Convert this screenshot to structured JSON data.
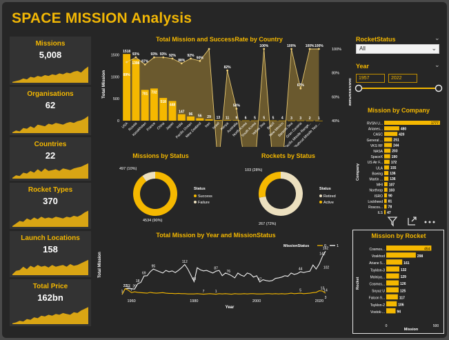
{
  "title": "SPACE MISSION Analysis",
  "kpis": [
    {
      "label": "Missions",
      "value": "5,008"
    },
    {
      "label": "Organisations",
      "value": "62"
    },
    {
      "label": "Countries",
      "value": "22"
    },
    {
      "label": "Rocket Types",
      "value": "370"
    },
    {
      "label": "Launch Locations",
      "value": "158"
    },
    {
      "label": "Total Price",
      "value": "162bn"
    }
  ],
  "slicers": {
    "rocket_status_label": "RocketStatus",
    "rocket_status_value": "All",
    "year_label": "Year",
    "year_from": "1957",
    "year_to": "2022"
  },
  "colors": {
    "accent": "#f5b800",
    "dark_fill": "#6e5c2e",
    "panel": "#333333",
    "background": "#262626"
  },
  "chart_data": [
    {
      "type": "bar",
      "title": "Total Mission and SuccessRate by Country",
      "xlabel": "",
      "ylabel": "Total Mission",
      "y2label": "SuccessRate",
      "categories": [
        "USA",
        "Russia",
        "Kazakhstan",
        "France",
        "China",
        "Japan",
        "India",
        "Pacific Ocean",
        "New Zealand",
        "Iran",
        "Israel",
        "Kenya",
        "Australia",
        "North Korea",
        "South Korea",
        "Yellow Sea",
        "Brazil",
        "New Mexico",
        "Barents Sea",
        "Gran Canaria",
        "Pacific Missile Range...",
        "Shahrud Missile Test ..."
      ],
      "series": [
        {
          "values": [
            1518,
            1398,
            701,
            732,
            518,
            448,
            147,
            96,
            56,
            29,
            13,
            11,
            9,
            6,
            5,
            5,
            5,
            4,
            3,
            3,
            2,
            1
          ]
        },
        {
          "values": [
            89,
            93,
            87,
            93,
            93,
            92,
            88,
            92,
            90,
            100,
            0,
            82,
            50,
            0,
            0,
            100,
            0,
            0,
            100,
            67,
            100,
            100
          ]
        }
      ],
      "bar_labels": [
        "1518",
        "1398",
        "701",
        "732",
        "518",
        "448",
        "147",
        "96",
        "56",
        "29",
        "13",
        "11",
        "9",
        "6",
        "5",
        "5",
        "5",
        "4",
        "3",
        "3",
        "2",
        "1"
      ],
      "rate_labels": [
        "89%",
        "93%",
        "87%",
        "93%",
        "93%",
        "92%",
        "88%",
        "92%",
        "90%",
        "",
        "",
        "82%",
        "50%",
        "",
        "",
        "100%",
        "",
        "",
        "100%",
        "67%",
        "100%",
        "100%"
      ],
      "y2_ticks": [
        "100%",
        "80%",
        "60%",
        "40%"
      ]
    },
    {
      "type": "pie",
      "title": "Missions by Status",
      "legend_title": "Status",
      "categories": [
        "Success",
        "Failure"
      ],
      "values": [
        4534,
        497
      ],
      "labels": [
        "4534 (90%)",
        "497 (10%)"
      ],
      "colors": [
        "#f5b800",
        "#ece0bf"
      ]
    },
    {
      "type": "pie",
      "title": "Rockets by Status",
      "legend_title": "Status",
      "categories": [
        "Retired",
        "Active"
      ],
      "values": [
        267,
        103
      ],
      "labels": [
        "267 (72%)",
        "103 (28%)"
      ],
      "colors": [
        "#ece0bf",
        "#f5b800"
      ]
    },
    {
      "type": "line",
      "title": "Total Mission by Year and MissionStatus",
      "legend_title": "MissionStatus",
      "xlabel": "Year",
      "ylabel": "Total Mission",
      "x_ticks": [
        "1960",
        "1980",
        "2000",
        "2020"
      ],
      "xlim": [
        1957,
        2022
      ],
      "series": [
        {
          "name": "1",
          "points": [
            [
              1957,
              0
            ],
            [
              1958,
              22
            ],
            [
              1959,
              22
            ],
            [
              1960,
              21
            ],
            [
              1961,
              20
            ],
            [
              1962,
              40
            ],
            [
              1963,
              45
            ],
            [
              1964,
              69
            ],
            [
              1965,
              70
            ],
            [
              1966,
              85
            ],
            [
              1967,
              95
            ],
            [
              1968,
              90
            ],
            [
              1969,
              85
            ],
            [
              1970,
              80
            ],
            [
              1971,
              90
            ],
            [
              1972,
              85
            ],
            [
              1973,
              88
            ],
            [
              1974,
              82
            ],
            [
              1975,
              90
            ],
            [
              1976,
              100
            ],
            [
              1977,
              112
            ],
            [
              1978,
              95
            ],
            [
              1979,
              72
            ],
            [
              1980,
              48
            ],
            [
              1981,
              100
            ],
            [
              1982,
              92
            ],
            [
              1983,
              88
            ],
            [
              1984,
              90
            ],
            [
              1985,
              85
            ],
            [
              1986,
              80
            ],
            [
              1987,
              87
            ],
            [
              1988,
              90
            ],
            [
              1989,
              70
            ],
            [
              1990,
              80
            ],
            [
              1991,
              76
            ],
            [
              1992,
              70
            ],
            [
              1993,
              62
            ],
            [
              1994,
              80
            ],
            [
              1995,
              72
            ],
            [
              1996,
              68
            ],
            [
              1997,
              80
            ],
            [
              1998,
              76
            ],
            [
              1999,
              65
            ],
            [
              2000,
              70
            ],
            [
              2001,
              47
            ],
            [
              2002,
              55
            ],
            [
              2003,
              52
            ],
            [
              2004,
              50
            ],
            [
              2005,
              52
            ],
            [
              2006,
              60
            ],
            [
              2007,
              62
            ],
            [
              2008,
              65
            ],
            [
              2009,
              70
            ],
            [
              2010,
              68
            ],
            [
              2011,
              80
            ],
            [
              2012,
              75
            ],
            [
              2013,
              78
            ],
            [
              2014,
              85
            ],
            [
              2015,
              82
            ],
            [
              2016,
              85
            ],
            [
              2017,
              87
            ],
            [
              2018,
              110
            ],
            [
              2019,
              95
            ],
            [
              2020,
              114
            ],
            [
              2021,
              142
            ],
            [
              2022,
              162
            ]
          ],
          "point_labels": {
            "1958": "22",
            "1959": "22",
            "1961": "20",
            "1962": "18",
            "1964": "69",
            "1967": "95",
            "1977": "112",
            "1980": "48",
            "1987": "87",
            "1991": "76",
            "2001": "47",
            "2014": "44",
            "2021": "142",
            "2022": "162"
          }
        },
        {
          "name": "0",
          "points": [
            [
              1957,
              1
            ],
            [
              1958,
              22
            ],
            [
              1959,
              16
            ],
            [
              1960,
              7
            ],
            [
              1961,
              10
            ],
            [
              1962,
              8
            ],
            [
              1963,
              7
            ],
            [
              1964,
              6
            ],
            [
              1965,
              5
            ],
            [
              1966,
              8
            ],
            [
              1967,
              6
            ],
            [
              1968,
              5
            ],
            [
              1969,
              6
            ],
            [
              1970,
              7
            ],
            [
              1971,
              5
            ],
            [
              1972,
              4
            ],
            [
              1973,
              4
            ],
            [
              1974,
              3
            ],
            [
              1975,
              4
            ],
            [
              1976,
              3
            ],
            [
              1977,
              3
            ],
            [
              1978,
              2
            ],
            [
              1979,
              2
            ],
            [
              1980,
              2
            ],
            [
              1981,
              3
            ],
            [
              1982,
              2
            ],
            [
              1983,
              1
            ],
            [
              1984,
              2
            ],
            [
              1985,
              3
            ],
            [
              1986,
              2
            ],
            [
              1987,
              1
            ],
            [
              1988,
              3
            ],
            [
              1989,
              2
            ],
            [
              1990,
              3
            ],
            [
              1991,
              2
            ],
            [
              1992,
              1
            ],
            [
              1993,
              3
            ],
            [
              1994,
              2
            ],
            [
              1995,
              2
            ],
            [
              1996,
              3
            ],
            [
              1997,
              2
            ],
            [
              1998,
              3
            ],
            [
              1999,
              3
            ],
            [
              2000,
              2
            ],
            [
              2001,
              2
            ],
            [
              2002,
              2
            ],
            [
              2003,
              3
            ],
            [
              2004,
              3
            ],
            [
              2005,
              2
            ],
            [
              2006,
              3
            ],
            [
              2007,
              2
            ],
            [
              2008,
              3
            ],
            [
              2009,
              2
            ],
            [
              2010,
              3
            ],
            [
              2011,
              5
            ],
            [
              2012,
              3
            ],
            [
              2013,
              4
            ],
            [
              2014,
              5
            ],
            [
              2015,
              3
            ],
            [
              2016,
              4
            ],
            [
              2017,
              5
            ],
            [
              2018,
              7
            ],
            [
              2019,
              8
            ],
            [
              2020,
              14
            ],
            [
              2021,
              13
            ],
            [
              2022,
              5
            ]
          ],
          "point_labels": {
            "1957": "1",
            "1958": "22",
            "1959": "16",
            "1960": "7",
            "1987": "1",
            "1983": "7",
            "2014": "5",
            "2021": "13",
            "2022": "14"
          }
        }
      ],
      "extra_labels": [
        "102",
        "3"
      ]
    },
    {
      "type": "bar",
      "orientation": "horizontal",
      "title": "Mission by Company",
      "ylabel": "Company",
      "categories": [
        "RVSN U...",
        "Arianes...",
        "CASC",
        "General ...",
        "VKS RF",
        "NASA",
        "SpaceX",
        "US Air F...",
        "ULA",
        "Boeing",
        "Martin ...",
        "MHI",
        "Northrop",
        "ISRO",
        "Lockheed",
        "Roscos...",
        "ILS"
      ],
      "values": [
        1777,
        480,
        420,
        251,
        244,
        203,
        190,
        172,
        155,
        136,
        136,
        107,
        103,
        90,
        81,
        78,
        47
      ]
    },
    {
      "type": "bar",
      "orientation": "horizontal",
      "title": "Mission by Rocket",
      "xlabel": "Mission",
      "ylabel": "Rocket",
      "x_ticks": [
        "0",
        "500"
      ],
      "xlim": [
        0,
        500
      ],
      "categories": [
        "Cosmos...",
        "Voskhod",
        "Ariane 5...",
        "Tsyklon-3",
        "Molniya...",
        "Cosmos...",
        "Soyuz U",
        "Falcon 9...",
        "Tsyklon-2",
        "Vostok-..."
      ],
      "values": [
        454,
        298,
        161,
        132,
        129,
        126,
        125,
        117,
        106,
        94
      ]
    }
  ]
}
